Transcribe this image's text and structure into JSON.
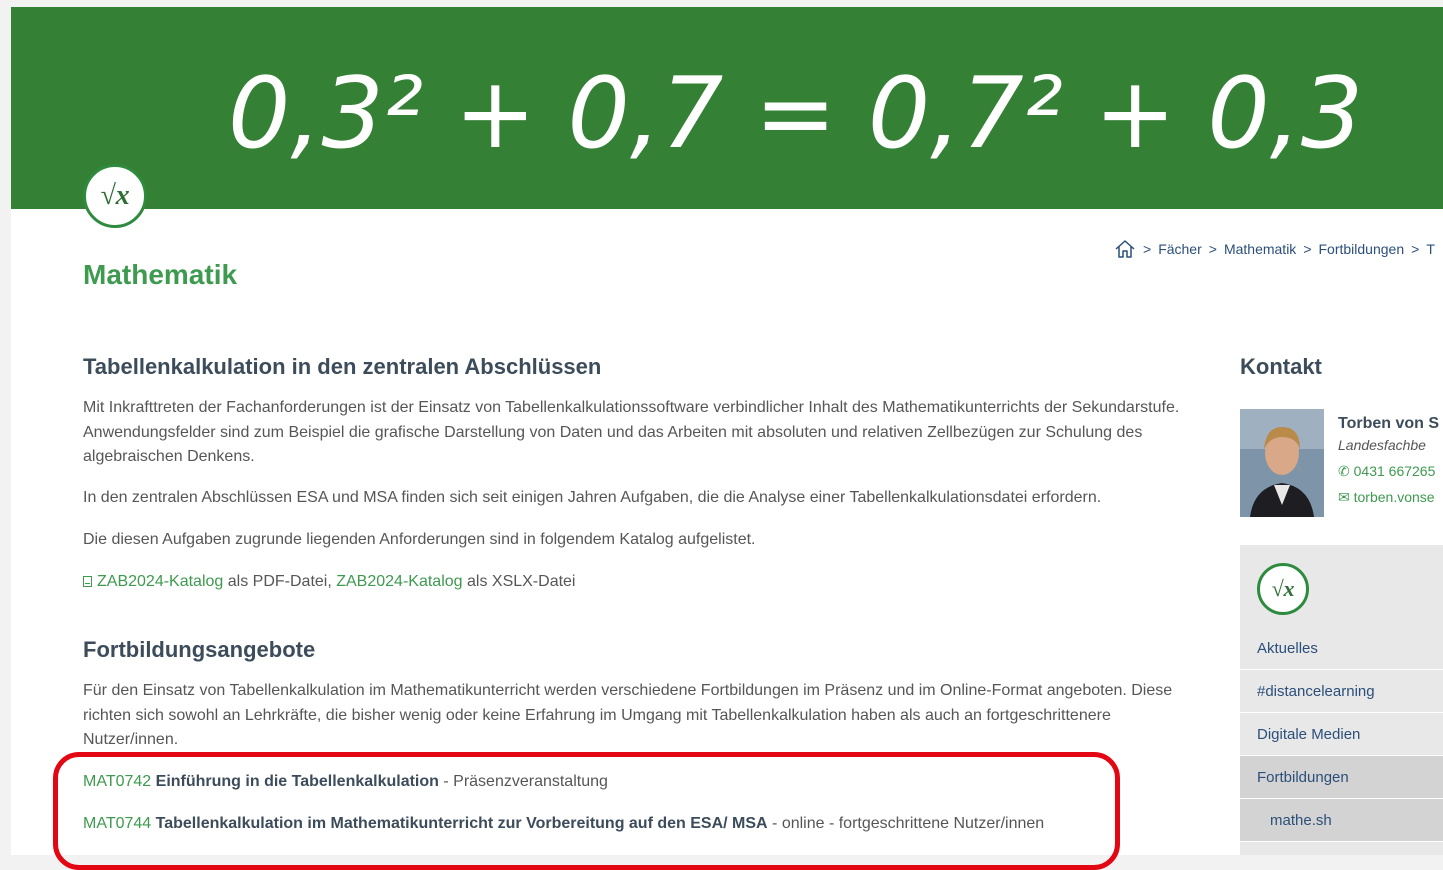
{
  "banner": {
    "equation": "0,3² + 0,7 = 0,7² + 0,3",
    "logo_text": "√x"
  },
  "site_title": "Mathematik",
  "breadcrumb": {
    "items": [
      "Fächer",
      "Mathematik",
      "Fortbildungen",
      "T"
    ]
  },
  "main": {
    "section1": {
      "heading": "Tabellenkalkulation in den zentralen Abschlüssen",
      "para1_line1": "Mit Inkrafttreten der Fachanforderungen ist der Einsatz von Tabellenkalkulationssoftware verbindlicher Inhalt des Mathematikunterrichts der Sekundarstufe.",
      "para1_line2": "Anwendungsfelder sind zum Beispiel die grafische Darstellung von Daten und das Arbeiten mit absoluten und relativen Zellbezügen zur Schulung des",
      "para1_line3": "algebraischen Denkens.",
      "para2": "In den zentralen Abschlüssen ESA und MSA finden sich seit einigen Jahren Aufgaben, die die Analyse einer Tabellenkalkulationsdatei erfordern.",
      "para3": "Die diesen Aufgaben zugrunde liegenden Anforderungen sind in folgendem Katalog aufgelistet.",
      "download_link1": "ZAB2024-Katalog",
      "download_text1": " als PDF-Datei, ",
      "download_link2": "ZAB2024-Katalog",
      "download_text2": " als XSLX-Datei"
    },
    "section2": {
      "heading": "Fortbildungsangebote",
      "para_line1": "Für den Einsatz von Tabellenkalkulation im Mathematikunterricht werden verschiedene Fortbildungen im Präsenz und im Online-Format angeboten. Diese",
      "para_line2": "richten sich sowohl an Lehrkräfte, die bisher wenig oder keine Erfahrung im Umgang mit Tabellenkalkulation haben als auch an fortgeschrittenere",
      "para_line3": "Nutzer/innen.",
      "courses": [
        {
          "code": "MAT0742",
          "title": "Einführung in die Tabellenkalkulation",
          "suffix": " - Präsenzveranstaltung"
        },
        {
          "code": "MAT0744",
          "title": "Tabellenkalkulation im Mathematikunterricht zur Vorbereitung auf den ESA/ MSA",
          "suffix": " - online - fortgeschrittene Nutzer/innen"
        }
      ]
    }
  },
  "sidebar": {
    "heading": "Kontakt",
    "contact": {
      "name": "Torben von S",
      "role": "Landesfachbe",
      "phone": "0431 667265",
      "email": "torben.vonse"
    },
    "nav_logo_text": "√x",
    "nav_items": [
      "Aktuelles",
      "#distancelearning",
      "Digitale Medien",
      "Fortbildungen",
      "mathe.sh"
    ]
  },
  "colors": {
    "banner_green": "#348035",
    "accent_green": "#3e9a4f",
    "heading_dark": "#3d4c5a",
    "link_blue": "#2b4f7a",
    "highlight_red": "#e30613"
  }
}
